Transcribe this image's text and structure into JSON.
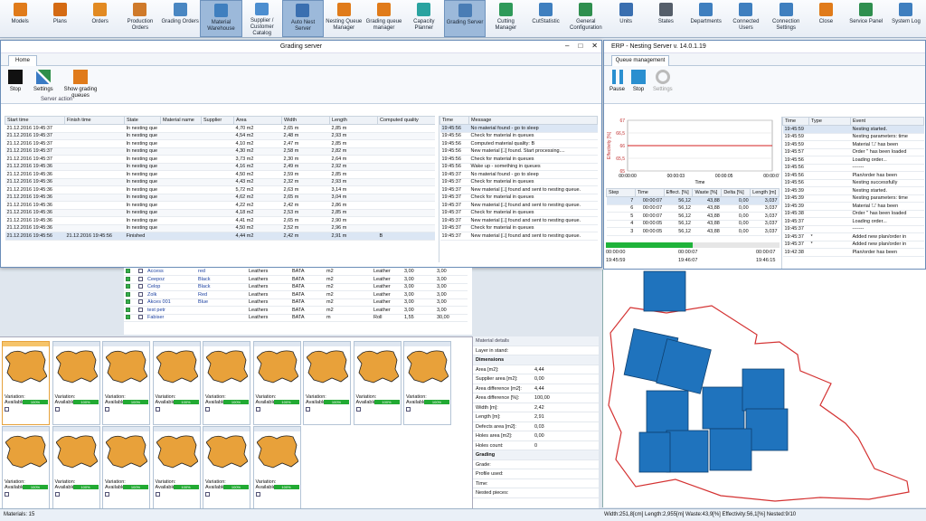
{
  "ribbon": [
    {
      "label": "Models",
      "icon": "models-icon",
      "color": "#e07b1a"
    },
    {
      "label": "Plans",
      "icon": "plans-icon",
      "color": "#d46a12"
    },
    {
      "label": "Orders",
      "icon": "orders-icon",
      "color": "#e28a22"
    },
    {
      "label": "Production Orders",
      "icon": "production-orders-icon",
      "color": "#cf7a2a"
    },
    {
      "label": "Grading Orders",
      "icon": "grading-orders-icon",
      "color": "#4a87c2"
    },
    {
      "label": "Material Warehouse",
      "icon": "warehouse-icon",
      "color": "#3f7fbf",
      "active": true
    },
    {
      "label": "Supplier / Customer Catalog",
      "icon": "catalog-icon",
      "color": "#4c8ed0"
    },
    {
      "label": "Auto Nest Server",
      "icon": "auto-nest-icon",
      "color": "#3a6fb0",
      "active": true
    },
    {
      "label": "Nesting Queue Manager",
      "icon": "queue-icon",
      "color": "#e07b1a"
    },
    {
      "label": "Grading queue manager",
      "icon": "grading-queue-icon",
      "color": "#e07b1a"
    },
    {
      "label": "Capacity Planner",
      "icon": "capacity-icon",
      "color": "#2aa3a0"
    },
    {
      "label": "Grading Server",
      "icon": "grading-server-icon",
      "color": "#4a7db5",
      "active": true
    },
    {
      "label": "Cutting Manager",
      "icon": "cutting-icon",
      "color": "#2f9a5a"
    },
    {
      "label": "CutStatistic",
      "icon": "statistic-icon",
      "color": "#3f7fbf"
    },
    {
      "label": "General Configuration",
      "icon": "config-icon",
      "color": "#2f8f4f"
    },
    {
      "label": "Units",
      "icon": "units-icon",
      "color": "#3a6fb0"
    },
    {
      "label": "States",
      "icon": "states-icon",
      "color": "#555e6a"
    },
    {
      "label": "Departments",
      "icon": "departments-icon",
      "color": "#3f7fbf"
    },
    {
      "label": "Connected Users",
      "icon": "users-icon",
      "color": "#3f7fbf"
    },
    {
      "label": "Connection Settings",
      "icon": "connection-icon",
      "color": "#3f7fbf"
    },
    {
      "label": "Close",
      "icon": "close-icon",
      "color": "#e07b1a"
    },
    {
      "label": "Service Panel",
      "icon": "service-icon",
      "color": "#2f8f4f"
    },
    {
      "label": "System Log",
      "icon": "log-icon",
      "color": "#3f7fbf"
    }
  ],
  "grading": {
    "title": "Grading server",
    "tab": "Home",
    "stop": "Stop",
    "settings": "Settings",
    "show": "Show grading queues",
    "group": "Server action",
    "cols": [
      "Start time",
      "Finish time",
      "State",
      "Material name",
      "Supplier",
      "Area",
      "Width",
      "Length",
      "Computed quality"
    ],
    "rows": [
      [
        "21.12.2016 19:45:37",
        "",
        "In nesting que",
        "",
        "",
        "4,70 m2",
        "2,65 m",
        "2,85 m",
        ""
      ],
      [
        "21.12.2016 19:45:37",
        "",
        "In nesting que",
        "",
        "",
        "4,54 m2",
        "2,48 m",
        "2,93 m",
        ""
      ],
      [
        "21.12.2016 19:45:37",
        "",
        "In nesting que",
        "",
        "",
        "4,10 m2",
        "2,47 m",
        "2,85 m",
        ""
      ],
      [
        "21.12.2016 19:45:37",
        "",
        "In nesting que",
        "",
        "",
        "4,30 m2",
        "2,58 m",
        "2,82 m",
        ""
      ],
      [
        "21.12.2016 19:45:37",
        "",
        "In nesting que",
        "",
        "",
        "3,73 m2",
        "2,30 m",
        "2,64 m",
        ""
      ],
      [
        "21.12.2016 19:45:36",
        "",
        "In nesting que",
        "",
        "",
        "4,16 m2",
        "2,49 m",
        "2,92 m",
        ""
      ],
      [
        "21.12.2016 19:45:36",
        "",
        "In nesting que",
        "",
        "",
        "4,50 m2",
        "2,59 m",
        "2,85 m",
        ""
      ],
      [
        "21.12.2016 19:45:36",
        "",
        "In nesting que",
        "",
        "",
        "4,43 m2",
        "2,32 m",
        "2,93 m",
        ""
      ],
      [
        "21.12.2016 19:45:36",
        "",
        "In nesting que",
        "",
        "",
        "5,72 m2",
        "2,63 m",
        "3,14 m",
        ""
      ],
      [
        "21.12.2016 19:45:36",
        "",
        "In nesting que",
        "",
        "",
        "4,62 m2",
        "2,65 m",
        "3,04 m",
        ""
      ],
      [
        "21.12.2016 19:45:36",
        "",
        "In nesting que",
        "",
        "",
        "4,22 m2",
        "2,42 m",
        "2,86 m",
        ""
      ],
      [
        "21.12.2016 19:45:36",
        "",
        "In nesting que",
        "",
        "",
        "4,18 m2",
        "2,53 m",
        "2,85 m",
        ""
      ],
      [
        "21.12.2016 19:45:36",
        "",
        "In nesting que",
        "",
        "",
        "4,41 m2",
        "2,65 m",
        "2,90 m",
        ""
      ],
      [
        "21.12.2016 19:45:36",
        "",
        "In nesting que",
        "",
        "",
        "4,50 m2",
        "2,52 m",
        "2,96 m",
        ""
      ],
      [
        "21.12.2016 19:45:56",
        "21.12.2016 19:45:56",
        "Finished",
        "",
        "",
        "4,44 m2",
        "2,42 m",
        "2,91 m",
        "B"
      ]
    ],
    "logcols": [
      "Time",
      "Message"
    ],
    "log": [
      [
        "19:45:56",
        "No material found - go to sleep"
      ],
      [
        "19:45:56",
        "Check for material in queues"
      ],
      [
        "19:45:56",
        "Computed material quality: B"
      ],
      [
        "19:45:56",
        "New material [□] found. Start processing...."
      ],
      [
        "19:45:56",
        "Check for material in queues"
      ],
      [
        "19:45:56",
        "Wake up - something in queues"
      ],
      [
        "19:45:37",
        "No material found - go to sleep"
      ],
      [
        "19:45:37",
        "Check for material in queues"
      ],
      [
        "19:45:37",
        "New material [□] found and sent to nesting queue."
      ],
      [
        "19:45:37",
        "Check for material in queues"
      ],
      [
        "19:45:37",
        "New material [□] found and sent to nesting queue."
      ],
      [
        "19:45:37",
        "Check for material in queues"
      ],
      [
        "19:45:37",
        "New material [□] found and sent to nesting queue."
      ],
      [
        "19:45:37",
        "Check for material in queues"
      ],
      [
        "19:45:37",
        "New material [□] found and sent to nesting queue."
      ]
    ]
  },
  "nesting": {
    "title": "ERP - Nesting Server v. 14.0.1.19",
    "tab": "Queue management",
    "pause": "Pause",
    "stop": "Stop",
    "settings": "Settings",
    "chart": {
      "yticks": [
        "67",
        "66,5",
        "66",
        "65,5",
        "65"
      ],
      "xticks": [
        "00:00:00",
        "00:00:03",
        "00:00:05",
        "00:00:07"
      ],
      "xlabel": "Time",
      "ylabel": "Effectivity [%]",
      "value": 66
    },
    "stepcols": [
      "Step",
      "Time",
      "Effect. [%]",
      "Waste [%]",
      "Delta [%]",
      "Length [m]"
    ],
    "steps": [
      [
        "7",
        "00:00:07",
        "56,12",
        "43,88",
        "0,00",
        "3,037"
      ],
      [
        "6",
        "00:00:07",
        "56,12",
        "43,88",
        "0,00",
        "3,037"
      ],
      [
        "5",
        "00:00:07",
        "56,12",
        "43,88",
        "0,00",
        "3,037"
      ],
      [
        "4",
        "00:00:05",
        "56,12",
        "43,88",
        "0,00",
        "3,037"
      ],
      [
        "3",
        "00:00:05",
        "56,12",
        "43,88",
        "0,00",
        "3,037"
      ]
    ],
    "progress": [
      "00:00:00",
      "00:00:07",
      "00:00:07",
      "19:45:59",
      "19:46:07",
      "19:46:15"
    ],
    "evcols": [
      "Time",
      "Type",
      "Event"
    ],
    "events": [
      [
        "19:45:59",
        "",
        "Nesting started."
      ],
      [
        "19:45:59",
        "",
        "Nesting parameters: time"
      ],
      [
        "19:45:59",
        "",
        "Material '□' has been"
      ],
      [
        "19:45:57",
        "",
        "Order '' has been loaded"
      ],
      [
        "19:45:56",
        "",
        "Loading order..."
      ],
      [
        "19:45:56",
        "",
        "-------"
      ],
      [
        "19:45:56",
        "",
        "Plan/order has been"
      ],
      [
        "19:45:56",
        "",
        "Nesting successfully"
      ],
      [
        "19:45:39",
        "",
        "Nesting started."
      ],
      [
        "19:45:39",
        "",
        "Nesting parameters: time"
      ],
      [
        "19:45:39",
        "",
        "Material '□' has been"
      ],
      [
        "19:45:38",
        "",
        "Order '' has been loaded"
      ],
      [
        "19:45:37",
        "",
        "Loading order..."
      ],
      [
        "19:45:37",
        "",
        "-------"
      ],
      [
        "19:45:37",
        "*",
        "Added new plan/order in"
      ],
      [
        "19:45:37",
        "*",
        "Added new plan/order in"
      ],
      [
        "19:42:38",
        "",
        "Plan/order has been"
      ]
    ],
    "status": "Width:251,8[cm]  Length:2,955[m]  Waste:43,9[%]  Effectivity:56,1[%]  Nested:9/10"
  },
  "materials": [
    [
      "Access",
      "red",
      "Leathers",
      "BATA",
      "m2",
      "Leather",
      "3,00",
      "3,00"
    ],
    [
      "Ceepoz",
      "Black",
      "Leathers",
      "BATA",
      "m2",
      "Leather",
      "3,00",
      "3,00"
    ],
    [
      "Celop",
      "Black",
      "Leathers",
      "BATA",
      "m2",
      "Leather",
      "3,00",
      "3,00"
    ],
    [
      "Zolk",
      "Red",
      "Leathers",
      "BATA",
      "m2",
      "Leather",
      "3,00",
      "3,00"
    ],
    [
      "Akces 001",
      "Blue",
      "Leathers",
      "BATA",
      "m2",
      "Leather",
      "3,00",
      "3,00"
    ],
    [
      "test petr",
      "",
      "Leathers",
      "BATA",
      "m2",
      "Leather",
      "3,00",
      "3,00"
    ],
    [
      "Fabiser",
      "",
      "Leathers",
      "BATA",
      "m",
      "Roll",
      "1,55",
      "30,00"
    ]
  ],
  "tiles": {
    "variation": "Variation:",
    "available": "Available:",
    "bar": "100%"
  },
  "details": {
    "title": "Material details",
    "rows": [
      {
        "k": "Layer in stand:",
        "v": ""
      },
      {
        "sec": "Dimensions"
      },
      {
        "k": "Area [m2]:",
        "v": "4,44"
      },
      {
        "k": "Supplier area [m2]:",
        "v": "0,00"
      },
      {
        "k": "Area difference [m2]:",
        "v": "4,44"
      },
      {
        "k": "Area difference [%]:",
        "v": "100,00"
      },
      {
        "k": "Width [m]:",
        "v": "2,42"
      },
      {
        "k": "Length [m]:",
        "v": "2,91"
      },
      {
        "k": "Defects area [m2]:",
        "v": "0,03"
      },
      {
        "k": "Holes area [m2]:",
        "v": "0,00"
      },
      {
        "k": "Holes count:",
        "v": "0"
      },
      {
        "sec": "Grading"
      },
      {
        "k": "Grade:",
        "v": ""
      },
      {
        "k": "Profile used:",
        "v": ""
      },
      {
        "k": "Time:",
        "v": ""
      },
      {
        "k": "Nested pieces:",
        "v": ""
      }
    ]
  },
  "statusbar": "Materials: 15"
}
